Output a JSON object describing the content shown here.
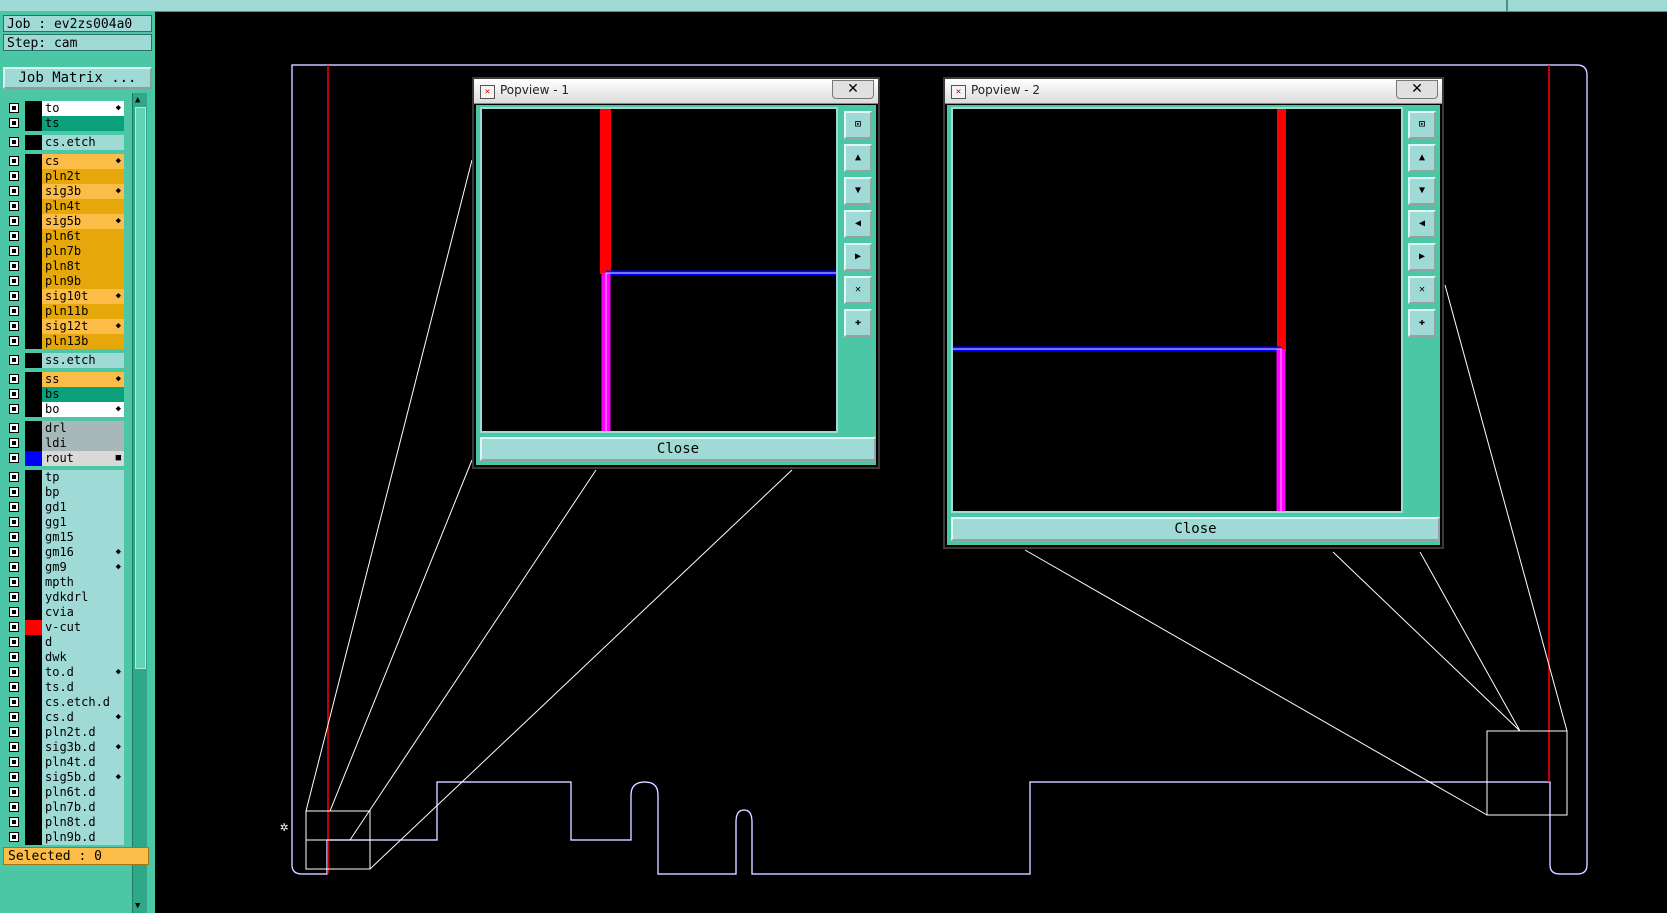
{
  "job_label": "Job : ev2zs004a0",
  "step_label": "Step: cam",
  "job_matrix_label": "Job Matrix ...",
  "selected_label": "Selected : 0",
  "colors": {
    "panel": "#4bc7a6",
    "light": "#9fdad6",
    "signal": "#fbbd47",
    "signal_dark": "#e6a70a",
    "mask": "#0aa07c",
    "drill": "#a8b7b8",
    "route": "#0000ff",
    "vcut": "#ff0000"
  },
  "layers": [
    {
      "name": "to",
      "color": "#ffffff",
      "mark": "◆"
    },
    {
      "name": "ts",
      "color": "#0aa07c",
      "mark": ""
    },
    {
      "name": "cs.etch",
      "color": "#9fdad6",
      "mark": ""
    },
    {
      "name": "cs",
      "color": "#fbbd47",
      "mark": "◆"
    },
    {
      "name": "pln2t",
      "color": "#e6a70a",
      "mark": ""
    },
    {
      "name": "sig3b",
      "color": "#fbbd47",
      "mark": "◆"
    },
    {
      "name": "pln4t",
      "color": "#e6a70a",
      "mark": ""
    },
    {
      "name": "sig5b",
      "color": "#fbbd47",
      "mark": "◆"
    },
    {
      "name": "pln6t",
      "color": "#e6a70a",
      "mark": ""
    },
    {
      "name": "pln7b",
      "color": "#e6a70a",
      "mark": ""
    },
    {
      "name": "pln8t",
      "color": "#e6a70a",
      "mark": ""
    },
    {
      "name": "pln9b",
      "color": "#e6a70a",
      "mark": ""
    },
    {
      "name": "sig10t",
      "color": "#fbbd47",
      "mark": "◆"
    },
    {
      "name": "pln11b",
      "color": "#e6a70a",
      "mark": ""
    },
    {
      "name": "sig12t",
      "color": "#fbbd47",
      "mark": "◆"
    },
    {
      "name": "pln13b",
      "color": "#e6a70a",
      "mark": ""
    },
    {
      "name": "ss.etch",
      "color": "#9fdad6",
      "mark": ""
    },
    {
      "name": "ss",
      "color": "#fbbd47",
      "mark": "◆"
    },
    {
      "name": "bs",
      "color": "#0aa07c",
      "mark": ""
    },
    {
      "name": "bo",
      "color": "#ffffff",
      "mark": "◆"
    },
    {
      "name": "drl",
      "color": "#a8b7b8",
      "mark": ""
    },
    {
      "name": "ldi",
      "color": "#a8b7b8",
      "mark": ""
    },
    {
      "name": "rout",
      "color": "#d9d9d9",
      "mark": "■",
      "swatch": "#0000ff"
    },
    {
      "name": "tp",
      "color": "#9fdad6",
      "mark": ""
    },
    {
      "name": "bp",
      "color": "#9fdad6",
      "mark": ""
    },
    {
      "name": "gd1",
      "color": "#9fdad6",
      "mark": ""
    },
    {
      "name": "gg1",
      "color": "#9fdad6",
      "mark": ""
    },
    {
      "name": "gm15",
      "color": "#9fdad6",
      "mark": ""
    },
    {
      "name": "gm16",
      "color": "#9fdad6",
      "mark": "◆"
    },
    {
      "name": "gm9",
      "color": "#9fdad6",
      "mark": "◆"
    },
    {
      "name": "mpth",
      "color": "#9fdad6",
      "mark": ""
    },
    {
      "name": "ydkdrl",
      "color": "#9fdad6",
      "mark": ""
    },
    {
      "name": "cvia",
      "color": "#9fdad6",
      "mark": ""
    },
    {
      "name": "v-cut",
      "color": "#9fdad6",
      "mark": "",
      "swatch": "#ff0000"
    },
    {
      "name": "d",
      "color": "#9fdad6",
      "mark": ""
    },
    {
      "name": "dwk",
      "color": "#9fdad6",
      "mark": ""
    },
    {
      "name": "to.d",
      "color": "#9fdad6",
      "mark": "◆"
    },
    {
      "name": "ts.d",
      "color": "#9fdad6",
      "mark": ""
    },
    {
      "name": "cs.etch.d",
      "color": "#9fdad6",
      "mark": ""
    },
    {
      "name": "cs.d",
      "color": "#9fdad6",
      "mark": "◆"
    },
    {
      "name": "pln2t.d",
      "color": "#9fdad6",
      "mark": ""
    },
    {
      "name": "sig3b.d",
      "color": "#9fdad6",
      "mark": "◆"
    },
    {
      "name": "pln4t.d",
      "color": "#9fdad6",
      "mark": ""
    },
    {
      "name": "sig5b.d",
      "color": "#9fdad6",
      "mark": "◆"
    },
    {
      "name": "pln6t.d",
      "color": "#9fdad6",
      "mark": ""
    },
    {
      "name": "pln7b.d",
      "color": "#9fdad6",
      "mark": ""
    },
    {
      "name": "pln8t.d",
      "color": "#9fdad6",
      "mark": ""
    },
    {
      "name": "pln9b.d",
      "color": "#9fdad6",
      "mark": ""
    }
  ],
  "popviews": [
    {
      "title": "Popview - 1",
      "close_label": "Close",
      "close_x": "✕"
    },
    {
      "title": "Popview - 2",
      "close_label": "Close",
      "close_x": "✕"
    }
  ],
  "popview_tools": [
    {
      "name": "zoom-home-icon",
      "glyph": "⊡"
    },
    {
      "name": "pan-up-icon",
      "glyph": "▲"
    },
    {
      "name": "pan-down-icon",
      "glyph": "▼"
    },
    {
      "name": "pan-left-icon",
      "glyph": "◀"
    },
    {
      "name": "pan-right-icon",
      "glyph": "▶"
    },
    {
      "name": "zoom-out-icon",
      "glyph": "✕"
    },
    {
      "name": "zoom-in-icon",
      "glyph": "✚"
    }
  ]
}
